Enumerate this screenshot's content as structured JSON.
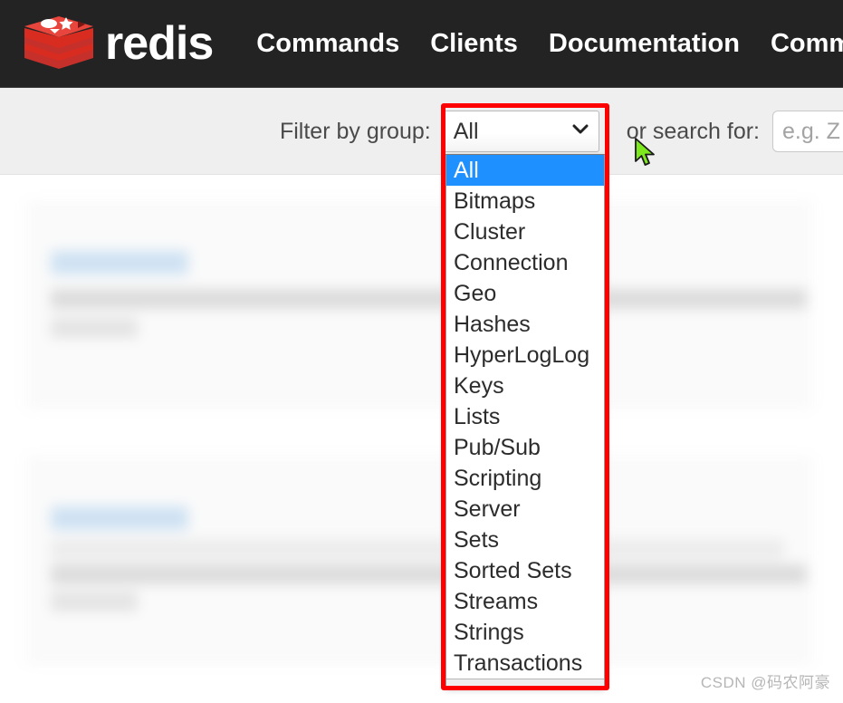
{
  "navbar": {
    "brand_word": "redis",
    "logo_icon": "redis-stack-logo",
    "links": [
      {
        "label": "Commands"
      },
      {
        "label": "Clients"
      },
      {
        "label": "Documentation"
      },
      {
        "label": "Communit"
      }
    ],
    "background_color": "#232323"
  },
  "filter_bar": {
    "group_label": "Filter by group:",
    "selected_group": "All",
    "caret_icon": "chevron-down-icon",
    "search_label": "or search for:",
    "search_value": "",
    "search_placeholder": "e.g. Z",
    "background_color": "#efefef"
  },
  "dropdown": {
    "expanded": true,
    "highlight_color": "#1e90ff",
    "annotation_color": "#fe0000",
    "options": [
      {
        "label": "All",
        "selected": true
      },
      {
        "label": "Bitmaps",
        "selected": false
      },
      {
        "label": "Cluster",
        "selected": false
      },
      {
        "label": "Connection",
        "selected": false
      },
      {
        "label": "Geo",
        "selected": false
      },
      {
        "label": "Hashes",
        "selected": false
      },
      {
        "label": "HyperLogLog",
        "selected": false
      },
      {
        "label": "Keys",
        "selected": false
      },
      {
        "label": "Lists",
        "selected": false
      },
      {
        "label": "Pub/Sub",
        "selected": false
      },
      {
        "label": "Scripting",
        "selected": false
      },
      {
        "label": "Server",
        "selected": false
      },
      {
        "label": "Sets",
        "selected": false
      },
      {
        "label": "Sorted Sets",
        "selected": false
      },
      {
        "label": "Streams",
        "selected": false
      },
      {
        "label": "Strings",
        "selected": false
      },
      {
        "label": "Transactions",
        "selected": false
      }
    ]
  },
  "content": {
    "obscured": true,
    "note": "command list cards blurred behind dropdown"
  },
  "cursor": {
    "icon": "arrow-pointer-cursor"
  },
  "watermark": {
    "text": "CSDN @码农阿豪"
  }
}
